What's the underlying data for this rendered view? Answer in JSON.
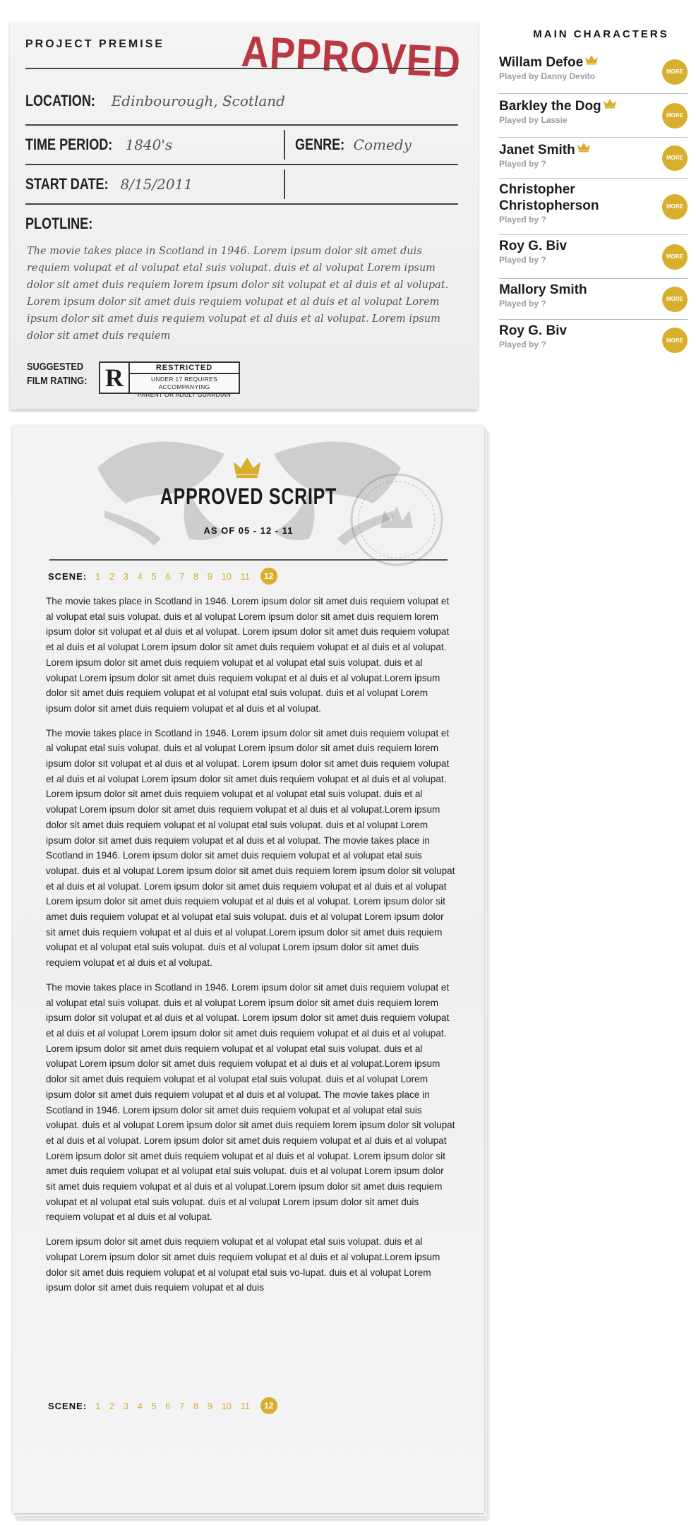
{
  "premise": {
    "header": "PROJECT PREMISE",
    "stamp": "APPROVED",
    "location_label": "LOCATION:",
    "location_value": "Edinbourough, Scotland",
    "time_period_label": "TIME PERIOD:",
    "time_period_value": "1840's",
    "genre_label": "GENRE:",
    "genre_value": "Comedy",
    "start_date_label": "START DATE:",
    "start_date_value": "8/15/2011",
    "plotline_label": "PLOTLINE:",
    "plotline_text": "The movie takes place in Scotland in 1946. Lorem ipsum dolor sit amet duis requiem volupat et al volupat etal suis volupat. duis et al volupat Lorem ipsum dolor sit amet duis requiem lorem ipsum dolor sit volupat et al duis et al volupat. Lorem ipsum dolor sit amet duis requiem volupat et al duis et al volupat Lorem ipsum dolor sit amet duis requiem volupat et al duis et al volupat. Lorem ipsum dolor sit amet duis requiem",
    "rating_label_1": "SUGGESTED",
    "rating_label_2": "FILM RATING:",
    "rating": {
      "letter": "R",
      "title": "RESTRICTED",
      "desc_1": "UNDER 17 REQUIRES ACCOMPANYING",
      "desc_2": "PARENT OR ADULT GUARDIAN"
    }
  },
  "characters": {
    "title": "MAIN CHARACTERS",
    "more_label": "MORE",
    "items": [
      {
        "name": "Willam Defoe",
        "sub": "Played by Danny Devito",
        "crown": true
      },
      {
        "name": "Barkley the Dog",
        "sub": "Played by Lassie",
        "crown": true
      },
      {
        "name": "Janet Smith",
        "sub": "Played by ?",
        "crown": true
      },
      {
        "name": "Christopher Christopherson",
        "sub": "Played by ?",
        "crown": false
      },
      {
        "name": "Roy G. Biv",
        "sub": "Played by ?",
        "crown": false
      },
      {
        "name": "Mallory Smith",
        "sub": "Played by ?",
        "crown": false
      },
      {
        "name": "Roy G. Biv",
        "sub": "Played by ?",
        "crown": false
      }
    ]
  },
  "script": {
    "title": "APPROVED SCRIPT",
    "as_of": "AS OF  05 - 12 - 11",
    "scene_label": "SCENE:",
    "scenes": [
      "1",
      "2",
      "3",
      "4",
      "5",
      "6",
      "7",
      "8",
      "9",
      "10",
      "11",
      "12"
    ],
    "active_scene": "12",
    "paragraphs": [
      "The movie takes place in Scotland in 1946. Lorem ipsum dolor sit amet duis requiem volupat et al volupat etal suis volupat. duis et al volupat Lorem ipsum dolor sit amet duis requiem lorem ipsum dolor sit volupat et al duis et al volupat. Lorem ipsum dolor sit amet duis requiem volupat et al duis et al volupat Lorem ipsum dolor sit amet duis requiem volupat et al duis et al volupat. Lorem ipsum dolor sit amet duis requiem volupat et al volupat etal suis volupat. duis et al volupat Lorem ipsum dolor sit amet duis requiem volupat et al duis et al volupat.Lorem ipsum dolor sit amet duis requiem volupat et al volupat etal suis volupat. duis et al volupat Lorem ipsum dolor sit amet duis requiem volupat et al duis et al volupat.",
      "The movie takes place in Scotland in 1946. Lorem ipsum dolor sit amet duis requiem volupat et al volupat etal suis volupat. duis et al volupat Lorem ipsum dolor sit amet duis requiem lorem ipsum dolor sit volupat et al duis et al volupat. Lorem ipsum dolor sit amet duis requiem volupat et al duis et al volupat Lorem ipsum dolor sit amet duis requiem volupat et al duis et al volupat. Lorem ipsum dolor sit amet duis requiem volupat et al volupat etal suis volupat. duis et al volupat Lorem ipsum dolor sit amet duis requiem volupat et al duis et al volupat.Lorem ipsum dolor sit amet duis requiem volupat et al volupat etal suis volupat. duis et al volupat Lorem ipsum dolor sit amet duis requiem volupat et al duis et al volupat. The movie takes place in Scotland in 1946. Lorem ipsum dolor sit amet duis requiem volupat et al volupat etal suis volupat. duis et al volupat Lorem ipsum dolor sit amet duis requiem lorem ipsum dolor sit volupat et al duis et al volupat. Lorem ipsum dolor sit amet duis requiem volupat et al duis et al volupat Lorem ipsum dolor sit amet duis requiem volupat et al duis et al volupat. Lorem ipsum dolor sit amet duis requiem volupat et al volupat etal suis volupat. duis et al volupat Lorem ipsum dolor sit amet duis requiem volupat et al duis et al volupat.Lorem ipsum dolor sit amet duis requiem volupat et al volupat etal suis volupat. duis et al volupat Lorem ipsum dolor sit amet duis requiem volupat et al duis et al volupat.",
      "The movie takes place in Scotland in 1946. Lorem ipsum dolor sit amet duis requiem volupat et al volupat etal suis volupat. duis et al volupat Lorem ipsum dolor sit amet duis requiem lorem ipsum dolor sit volupat et al duis et al volupat. Lorem ipsum dolor sit amet duis requiem volupat et al duis et al volupat Lorem ipsum dolor sit amet duis requiem volupat et al duis et al volupat. Lorem ipsum dolor sit amet duis requiem volupat et al volupat etal suis volupat. duis et al volupat Lorem ipsum dolor sit amet duis requiem volupat et al duis et al volupat.Lorem ipsum dolor sit amet duis requiem volupat et al volupat etal suis volupat. duis et al volupat Lorem ipsum dolor sit amet duis requiem volupat et al duis et al volupat. The movie takes place in Scotland in 1946. Lorem ipsum dolor sit amet duis requiem volupat et al volupat etal suis volupat. duis et al volupat Lorem ipsum dolor sit amet duis requiem lorem ipsum dolor sit volupat et al duis et al volupat. Lorem ipsum dolor sit amet duis requiem volupat et al duis et al volupat Lorem ipsum dolor sit amet duis requiem volupat et al duis et al volupat. Lorem ipsum dolor sit amet duis requiem volupat et al volupat etal suis volupat. duis et al volupat Lorem ipsum dolor sit amet duis requiem volupat et al duis et al volupat.Lorem ipsum dolor sit amet duis requiem volupat et al volupat etal suis volupat. duis et al volupat Lorem ipsum dolor sit amet duis requiem volupat et al duis et al volupat.",
      "Lorem ipsum dolor sit amet duis requiem volupat et al volupat etal suis volupat. duis et al volupat Lorem ipsum dolor sit amet duis requiem volupat et al duis et al volupat.Lorem ipsum dolor sit amet duis requiem volupat et al volupat etal suis vo-lupat. duis et al volupat Lorem ipsum dolor sit amet duis requiem volupat et al duis"
    ]
  },
  "colors": {
    "accent": "#d8ae2d",
    "stamp": "#b3242e"
  }
}
